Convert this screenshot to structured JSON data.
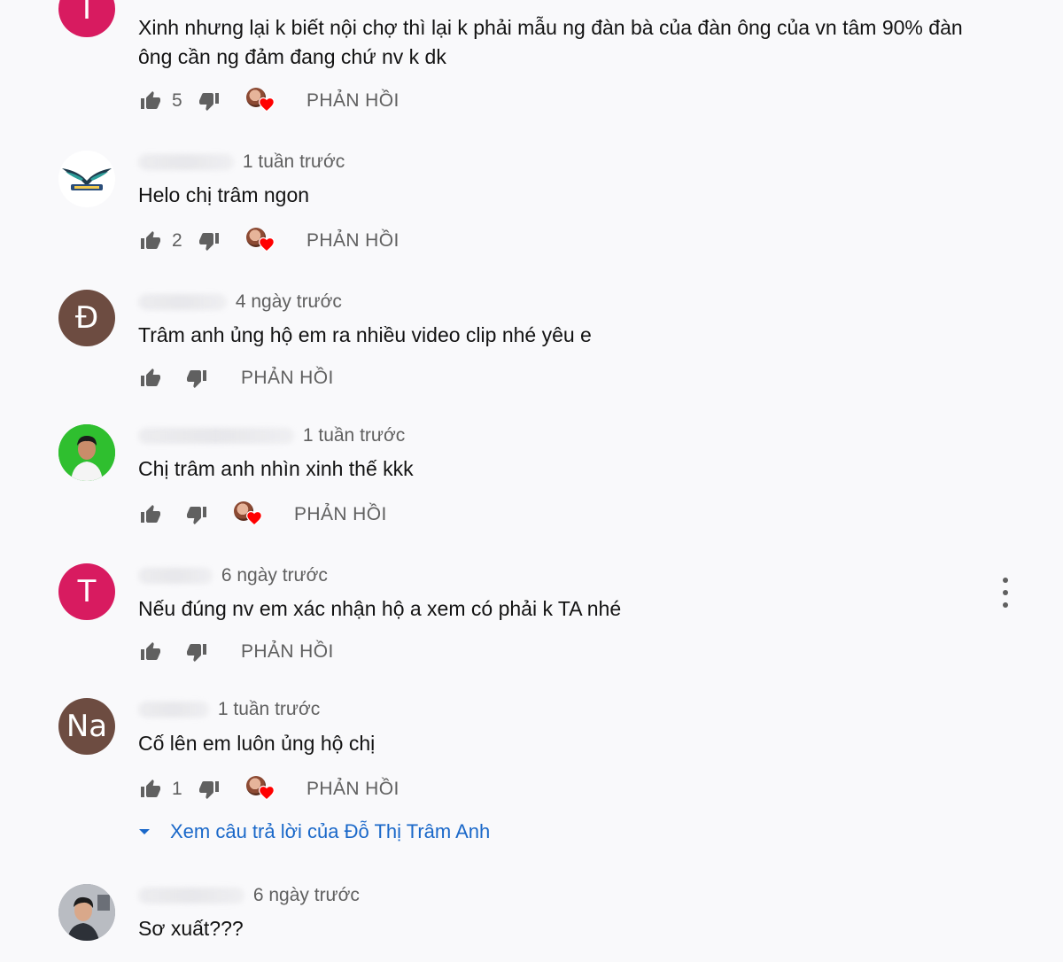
{
  "comments": [
    {
      "avatar_letter": "T",
      "avatar_color": "#d81b60",
      "time": "",
      "text": "Xinh nhưng lại k biết nội chợ thì lại k phải mẫu ng đàn bà của đàn ông của vn tâm 90% đàn ông cần ng đảm đang chứ nv k dk",
      "likes": "5",
      "reply_label": "PHẢN HỒI"
    },
    {
      "avatar_letter": "",
      "avatar_color": "#ffffff",
      "time": "1 tuần trước",
      "text": "Helo chị trâm ngon",
      "likes": "2",
      "reply_label": "PHẢN HỒI"
    },
    {
      "avatar_letter": "Đ",
      "avatar_color": "#6d4c41",
      "time": "4 ngày trước",
      "text": "Trâm anh ủng hộ em ra nhiều video clip nhé yêu e",
      "likes": "",
      "reply_label": "PHẢN HỒI"
    },
    {
      "avatar_letter": "",
      "avatar_color": "#2fbf2f",
      "time": "1 tuần trước",
      "text": "Chị trâm anh nhìn xinh thế kkk",
      "likes": "",
      "reply_label": "PHẢN HỒI"
    },
    {
      "avatar_letter": "T",
      "avatar_color": "#d81b60",
      "time": "6 ngày trước",
      "text": "Nếu đúng nv em xác nhận hộ a xem có phải k TA nhé",
      "likes": "",
      "reply_label": "PHẢN HỒI"
    },
    {
      "avatar_letter": "Na",
      "avatar_color": "#6d4c41",
      "time": "1 tuần trước",
      "text": "Cố lên em luôn ủng hộ chị",
      "likes": "1",
      "reply_label": "PHẢN HỒI",
      "view_replies_label": "Xem câu trả lời của Đỗ Thị Trâm Anh"
    },
    {
      "avatar_letter": "",
      "avatar_color": "#8a8f99",
      "time": "6 ngày trước",
      "text": "Sơ xuất???",
      "likes": "",
      "reply_label": ""
    }
  ],
  "icons": {
    "like": "thumb-up-icon",
    "dislike": "thumb-down-icon",
    "creator_heart": "creator-heart-icon",
    "more": "more-vert-icon",
    "expand": "caret-down-icon"
  },
  "colors": {
    "link_blue": "#1a68c9",
    "secondary_text": "#606060",
    "heart_red": "#ff0000"
  }
}
